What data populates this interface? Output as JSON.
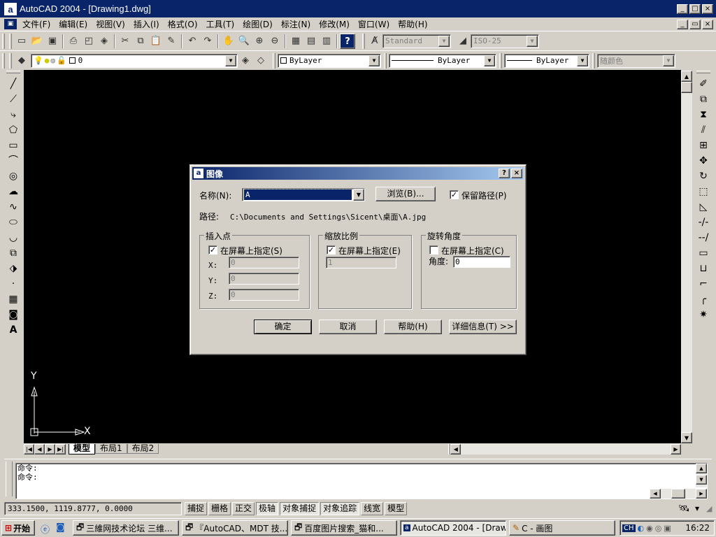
{
  "window": {
    "title": "AutoCAD 2004 - [Drawing1.dwg]",
    "app_icon": "a",
    "min": "_",
    "max": "□",
    "close": "×",
    "restore": "▭"
  },
  "menu": [
    "文件(F)",
    "编辑(E)",
    "视图(V)",
    "插入(I)",
    "格式(O)",
    "工具(T)",
    "绘图(D)",
    "标注(N)",
    "修改(M)",
    "窗口(W)",
    "帮助(H)"
  ],
  "toolbar": {
    "text_style": "Standard",
    "dim_style": "ISO-25"
  },
  "properties": {
    "layer": "0",
    "color": "ByLayer",
    "linetype": "ByLayer",
    "lineweight": "ByLayer",
    "plotstyle": "随颜色"
  },
  "ucs": {
    "x": "X",
    "y": "Y"
  },
  "tabs": [
    "模型",
    "布局1",
    "布局2"
  ],
  "dialog": {
    "title": "图像",
    "help": "?",
    "close": "×",
    "name_label": "名称(N):",
    "name_value": "A",
    "browse": "浏览(B)...",
    "keep_path": "保留路径(P)",
    "path_label": "路径:",
    "path_value": "C:\\Documents and Settings\\Sicent\\桌面\\A.jpg",
    "insert_point": {
      "title": "插入点",
      "specify": "在屏幕上指定(S)",
      "x_label": "X:",
      "y_label": "Y:",
      "z_label": "Z:",
      "x": "0",
      "y": "0",
      "z": "0"
    },
    "scale": {
      "title": "缩放比例",
      "specify": "在屏幕上指定(E)",
      "value": "1"
    },
    "rotation": {
      "title": "旋转角度",
      "specify": "在屏幕上指定(C)",
      "angle_label": "角度:",
      "angle": "0"
    },
    "ok": "确定",
    "cancel": "取消",
    "help_btn": "帮助(H)",
    "details": "详细信息(T) >>"
  },
  "command": {
    "line1": "命令:",
    "line2": "命令:"
  },
  "status": {
    "coords": "333.1500,    1119.8777,  0.0000",
    "buttons": [
      "捕捉",
      "栅格",
      "正交",
      "极轴",
      "对象捕捉",
      "对象追踪",
      "线宽",
      "模型"
    ]
  },
  "taskbar": {
    "start": "开始",
    "tasks": [
      "三維网技术论坛 三维...",
      "『AutoCAD、MDT 技...",
      "百度图片搜索_猫和...",
      "AutoCAD 2004 - [Drawi...",
      "C - 画图"
    ],
    "clock": "16:22",
    "ime": "CH"
  }
}
